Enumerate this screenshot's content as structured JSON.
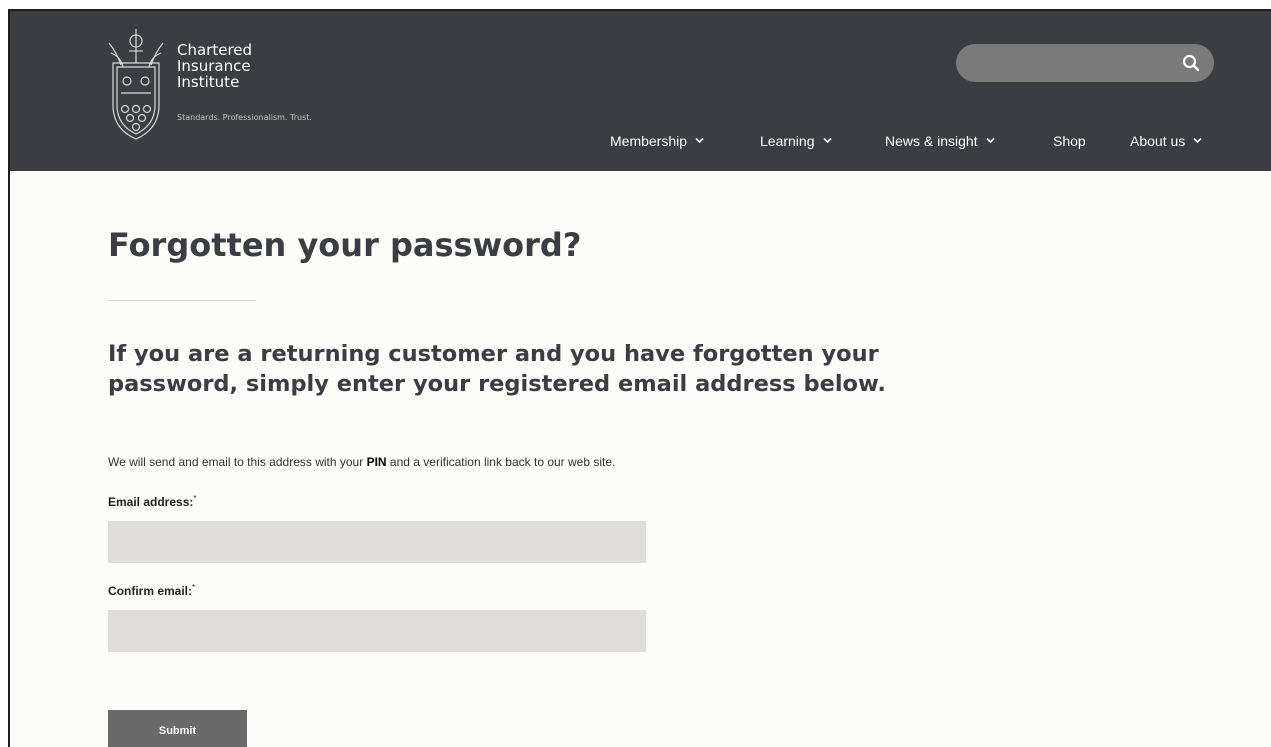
{
  "header": {
    "logo": {
      "name_lines": [
        "Chartered",
        "Insurance",
        "Institute"
      ],
      "tagline": "Standards. Professionalism. Trust."
    },
    "search": {
      "placeholder": ""
    },
    "nav": [
      {
        "label": "Membership",
        "has_dropdown": true
      },
      {
        "label": "Learning",
        "has_dropdown": true
      },
      {
        "label": "News & insight",
        "has_dropdown": true
      },
      {
        "label": "Shop",
        "has_dropdown": false
      },
      {
        "label": "About us",
        "has_dropdown": true
      }
    ]
  },
  "page": {
    "title": "Forgotten your password?",
    "subtitle": "If you are a returning customer and you have forgotten your password, simply enter your registered email address below.",
    "info_prefix": "We will send and email to this address with your ",
    "info_bold": "PIN",
    "info_suffix": " and a verification link back to our web site.",
    "form": {
      "email_label": "Email address:",
      "confirm_label": "Confirm email:",
      "required_marker": "*",
      "email_value": "",
      "confirm_value": "",
      "submit_label": "Submit"
    }
  },
  "colors": {
    "header_bg": "#3b3d42",
    "page_bg": "#fcfcf8",
    "input_bg": "#e0dcd7",
    "button_bg": "#6a6a6a"
  }
}
